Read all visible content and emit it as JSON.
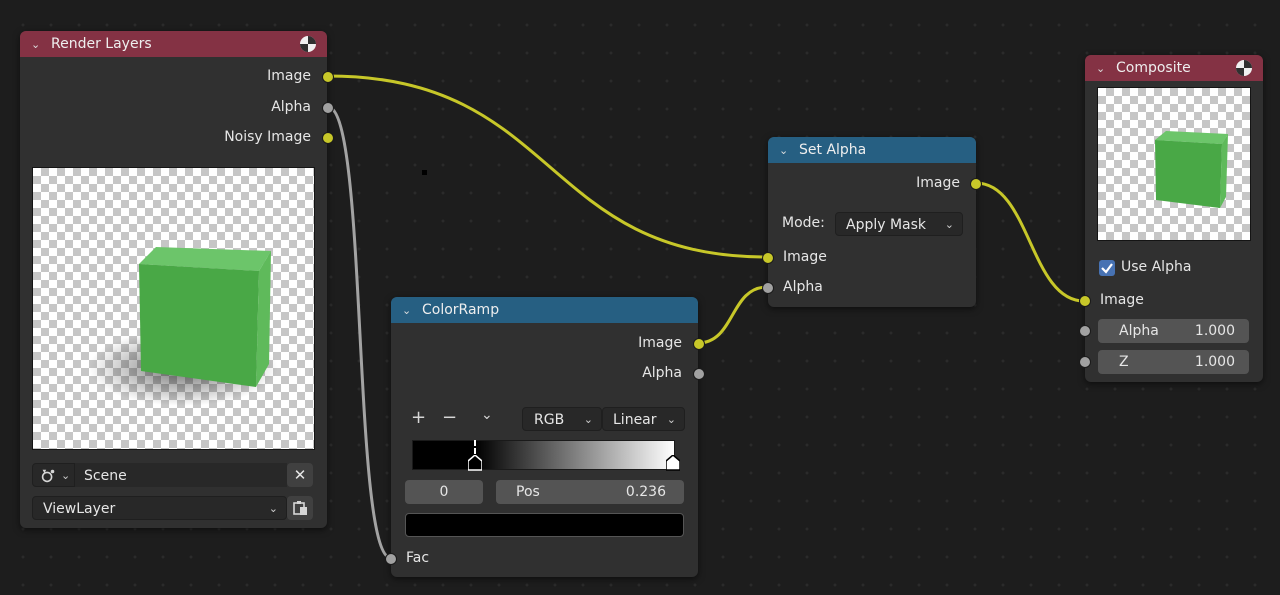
{
  "render_layers": {
    "title": "Render Layers",
    "outputs": [
      "Image",
      "Alpha",
      "Noisy Image"
    ],
    "scene": "Scene",
    "view_layer": "ViewLayer"
  },
  "colorramp": {
    "title": "ColorRamp",
    "outputs": [
      "Image",
      "Alpha"
    ],
    "input_fac": "Fac",
    "add": "+",
    "remove": "−",
    "menu": "⌄",
    "color_mode": "RGB",
    "interpolation": "Linear",
    "active_index": "0",
    "pos_label": "Pos",
    "pos_value": "0.236"
  },
  "set_alpha": {
    "title": "Set Alpha",
    "output": "Image",
    "mode_label": "Mode:",
    "mode_value": "Apply Mask",
    "inputs": [
      "Image",
      "Alpha"
    ]
  },
  "composite": {
    "title": "Composite",
    "use_alpha_label": "Use Alpha",
    "use_alpha": true,
    "input_image": "Image",
    "alpha_label": "Alpha",
    "alpha_value": "1.000",
    "z_label": "Z",
    "z_value": "1.000"
  },
  "colors": {
    "header_output": "#843244",
    "header_converter": "#265f82",
    "socket_color": "#c7c729",
    "socket_float": "#a1a1a1",
    "cube_green": "#4caf50"
  }
}
